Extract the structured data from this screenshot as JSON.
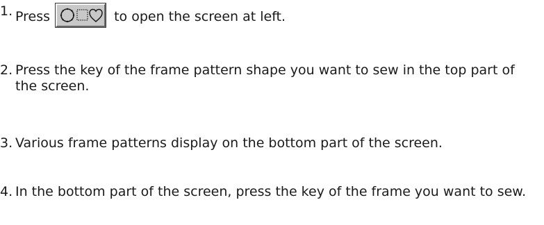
{
  "steps": [
    {
      "number": "1.",
      "text_before": "Press",
      "button_icon": "frame-shapes-icon",
      "text_after": "to open the screen at left."
    },
    {
      "number": "2.",
      "text": "Press the key of the frame pattern shape you want to sew in the top part of the screen."
    },
    {
      "number": "3.",
      "text": "Various frame patterns display on the bottom part of the screen."
    },
    {
      "number": "4.",
      "text": "In the bottom part of the screen, press the key of the frame you want to sew."
    }
  ]
}
